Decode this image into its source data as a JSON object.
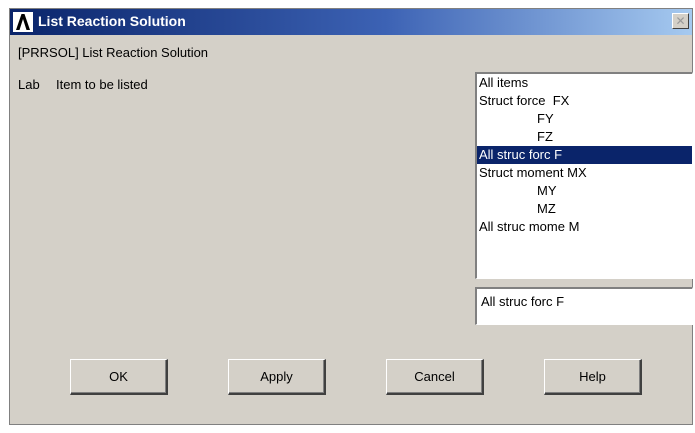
{
  "window": {
    "title": "List Reaction Solution",
    "close_glyph": "✕"
  },
  "command_label": "[PRRSOL] List Reaction Solution",
  "lab": {
    "label": "Lab",
    "description": "Item to be listed"
  },
  "listbox": {
    "items": [
      {
        "label": "All items"
      },
      {
        "label": "Struct force  FX"
      },
      {
        "label": "FY"
      },
      {
        "label": "FZ"
      },
      {
        "label": "All struc forc F"
      },
      {
        "label": "Struct moment MX"
      },
      {
        "label": "MY"
      },
      {
        "label": "MZ"
      },
      {
        "label": "All struc mome M"
      }
    ],
    "selected_value": "All struc forc F"
  },
  "buttons": {
    "ok": "OK",
    "apply": "Apply",
    "cancel": "Cancel",
    "help": "Help"
  },
  "colors": {
    "title_bar": "#0a246a",
    "selection": "#0a246a",
    "dialog_bg": "#d4d0c8"
  },
  "icons": {
    "app": "ansys-logo-icon",
    "close": "close-icon"
  }
}
